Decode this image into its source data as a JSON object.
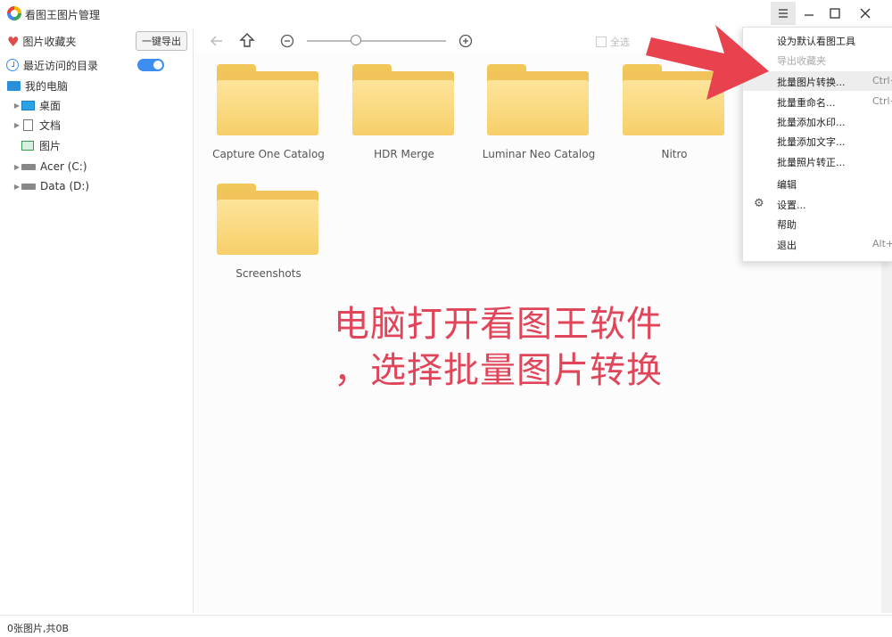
{
  "app": {
    "title": "看图王图片管理"
  },
  "window_controls": {
    "menu": "menu-icon",
    "minimize": "minimize-icon",
    "maximize": "maximize-icon",
    "close": "close-icon"
  },
  "sidebar": {
    "favorites_label": "图片收藏夹",
    "export_button": "一键导出",
    "recent_label": "最近访问的目录",
    "recent_toggle_on": true,
    "my_computer_label": "我的电脑",
    "tree": [
      {
        "label": "桌面",
        "icon": "desktop-icon"
      },
      {
        "label": "文档",
        "icon": "document-icon"
      },
      {
        "label": "图片",
        "icon": "picture-icon"
      },
      {
        "label": "Acer (C:)",
        "icon": "drive-icon"
      },
      {
        "label": "Data (D:)",
        "icon": "drive-icon"
      }
    ]
  },
  "toolbar": {
    "select_all": "全选",
    "zoom_level": 0.35,
    "icons": [
      "back-icon",
      "up-icon",
      "zoom-out-icon",
      "zoom-in-icon"
    ]
  },
  "folders": [
    {
      "name": "Capture One Catalog"
    },
    {
      "name": "HDR Merge"
    },
    {
      "name": "Luminar Neo Catalog"
    },
    {
      "name": "Nitro"
    },
    {
      "name": "Screenshots"
    }
  ],
  "annotation": {
    "line1": "电脑打开看图王软件",
    "line2": "，选择批量图片转换",
    "color": "#e0455a"
  },
  "menu": {
    "items": [
      {
        "label": "设为默认看图工具",
        "shortcut": ""
      },
      {
        "label": "导出收藏夹",
        "shortcut": "",
        "disabled": true
      },
      {
        "label": "批量图片转换...",
        "shortcut": "Ctrl+"
      },
      {
        "label": "批量重命名...",
        "shortcut": "Ctrl+"
      },
      {
        "label": "批量添加水印...",
        "shortcut": ""
      },
      {
        "label": "批量添加文字...",
        "shortcut": ""
      },
      {
        "label": "批量照片转正...",
        "shortcut": ""
      },
      {
        "label": "编辑",
        "shortcut": ""
      },
      {
        "label": "设置...",
        "shortcut": "",
        "icon": "gear-icon"
      },
      {
        "label": "帮助",
        "shortcut": ""
      },
      {
        "label": "退出",
        "shortcut": "Alt+"
      }
    ]
  },
  "status": {
    "text": "0张图片,共0B"
  },
  "colors": {
    "accent": "#3d8ef0",
    "arrow": "#e8424f",
    "folder": "#f7cf69"
  }
}
